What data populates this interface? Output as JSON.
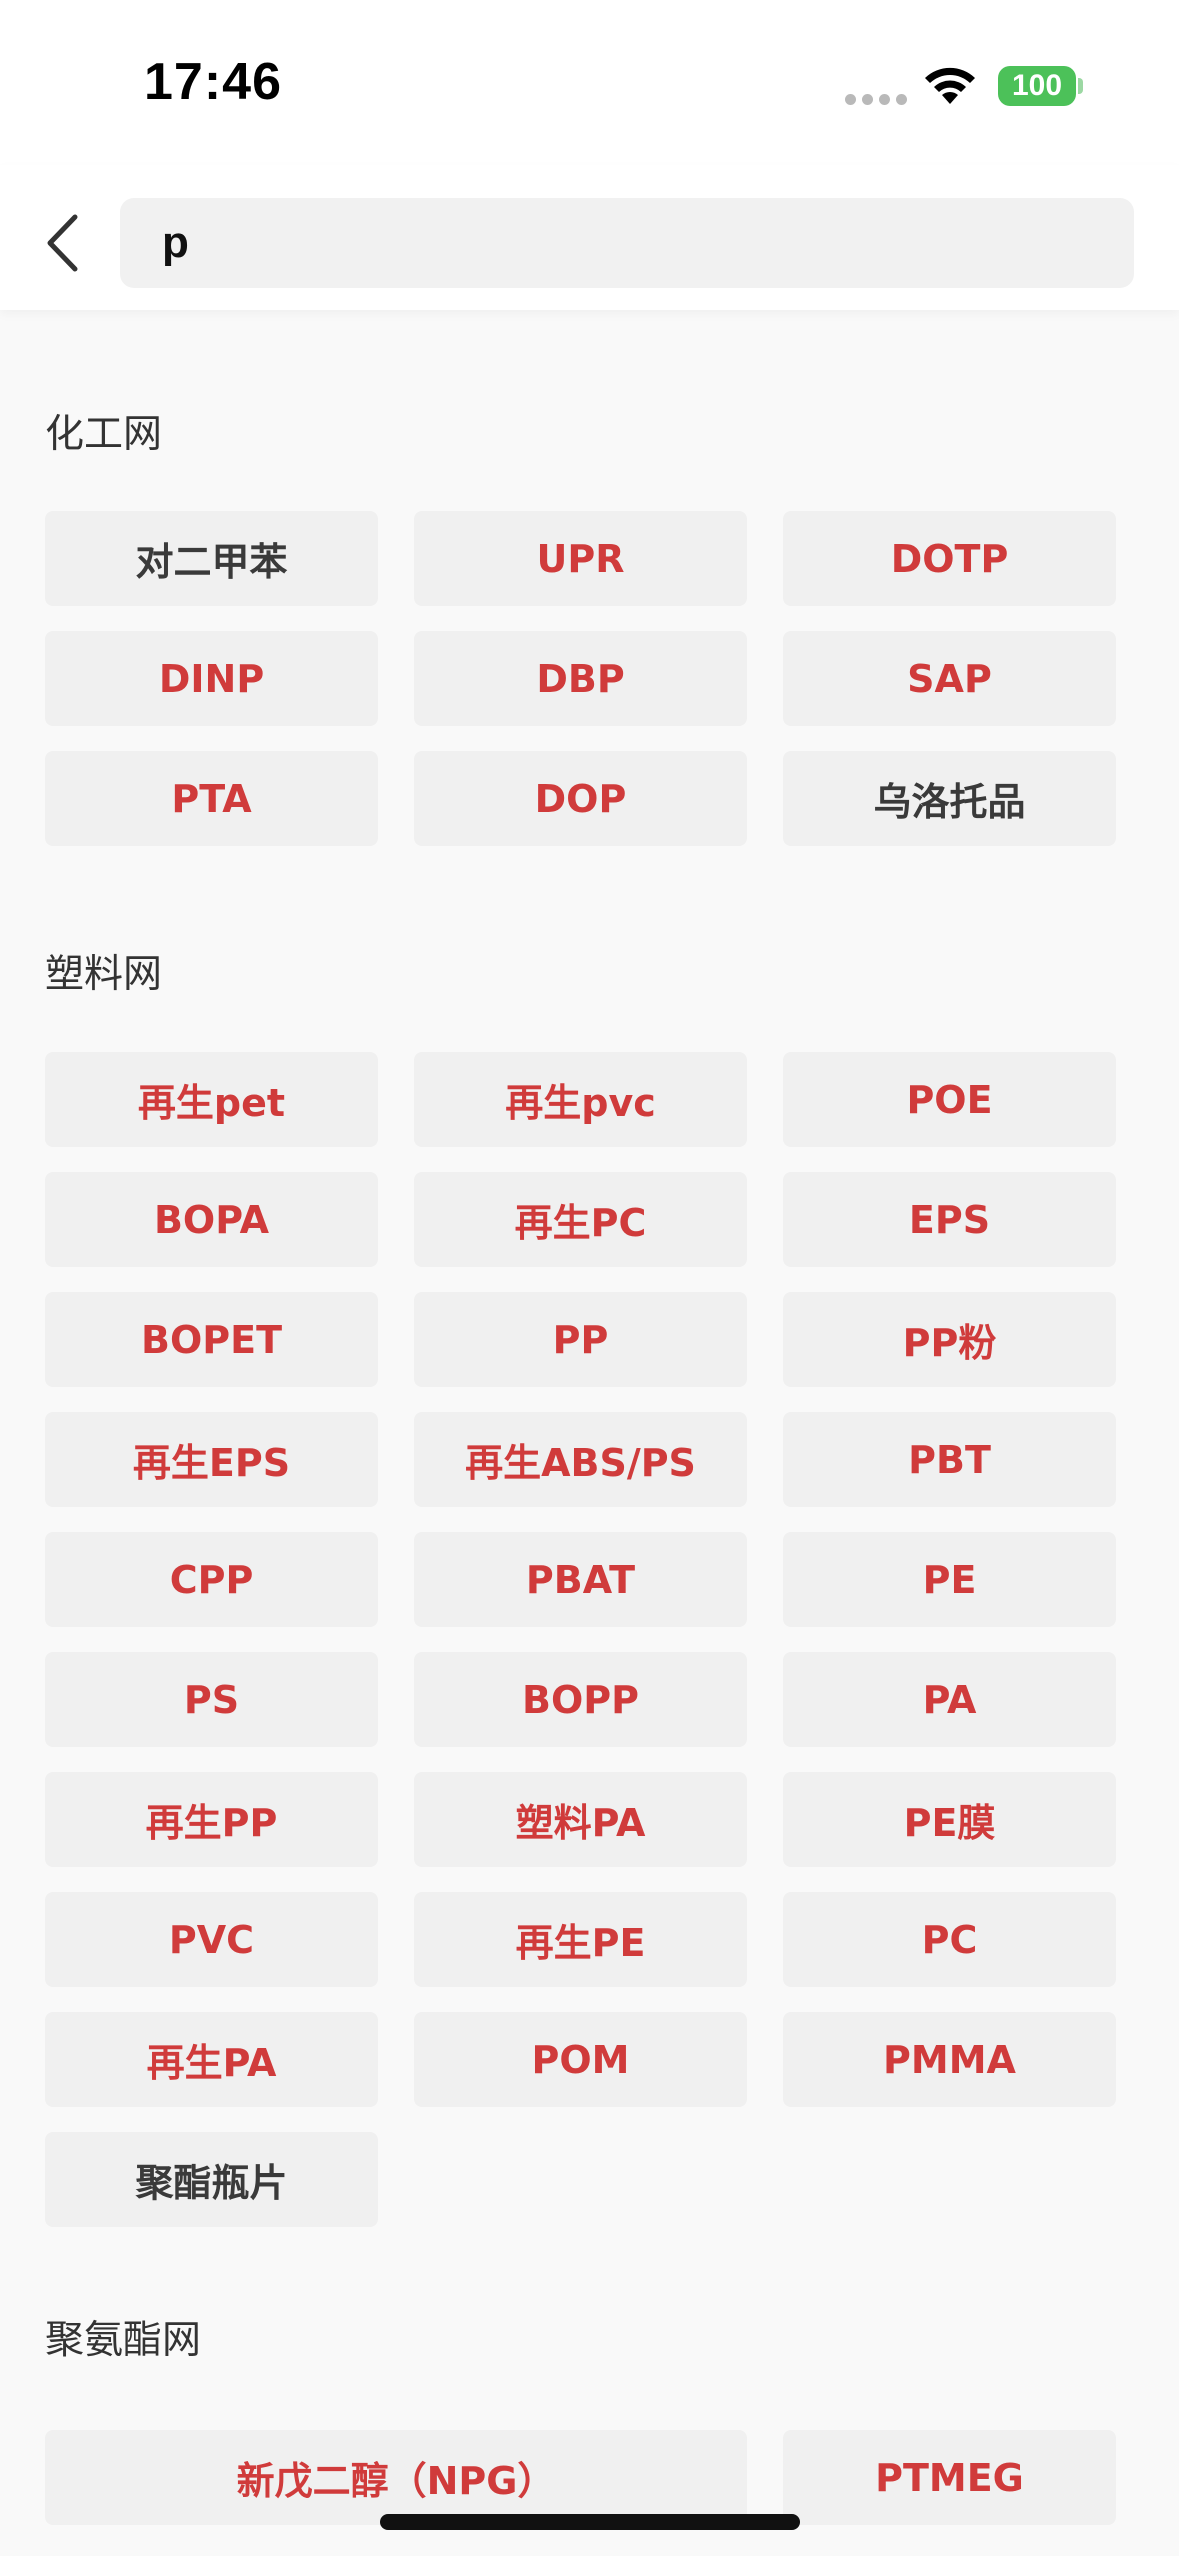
{
  "status_bar": {
    "time": "17:46",
    "battery": "100",
    "icons": [
      "signal-dots-icon",
      "wifi-icon",
      "battery-icon"
    ]
  },
  "nav": {
    "back_icon": "chevron-left-icon",
    "search_value": "p"
  },
  "sections": [
    {
      "title": "化工网",
      "items": [
        {
          "label": "对二甲苯",
          "highlight": false
        },
        {
          "label": "UPR",
          "highlight": true
        },
        {
          "label": "DOTP",
          "highlight": true
        },
        {
          "label": "DINP",
          "highlight": true
        },
        {
          "label": "DBP",
          "highlight": true
        },
        {
          "label": "SAP",
          "highlight": true
        },
        {
          "label": "PTA",
          "highlight": true
        },
        {
          "label": "DOP",
          "highlight": true
        },
        {
          "label": "乌洛托品",
          "highlight": false
        }
      ]
    },
    {
      "title": "塑料网",
      "items": [
        {
          "label": "再生pet",
          "highlight": true
        },
        {
          "label": "再生pvc",
          "highlight": true
        },
        {
          "label": "POE",
          "highlight": true
        },
        {
          "label": "BOPA",
          "highlight": true
        },
        {
          "label": "再生PC",
          "highlight": true
        },
        {
          "label": "EPS",
          "highlight": true
        },
        {
          "label": "BOPET",
          "highlight": true
        },
        {
          "label": "PP",
          "highlight": true
        },
        {
          "label": "PP粉",
          "highlight": true
        },
        {
          "label": "再生EPS",
          "highlight": true
        },
        {
          "label": "再生ABS/PS",
          "highlight": true
        },
        {
          "label": "PBT",
          "highlight": true
        },
        {
          "label": "CPP",
          "highlight": true
        },
        {
          "label": "PBAT",
          "highlight": true
        },
        {
          "label": "PE",
          "highlight": true
        },
        {
          "label": "PS",
          "highlight": true
        },
        {
          "label": "BOPP",
          "highlight": true
        },
        {
          "label": "PA",
          "highlight": true
        },
        {
          "label": "再生PP",
          "highlight": true
        },
        {
          "label": "塑料PA",
          "highlight": true
        },
        {
          "label": "PE膜",
          "highlight": true
        },
        {
          "label": "PVC",
          "highlight": true
        },
        {
          "label": "再生PE",
          "highlight": true
        },
        {
          "label": "PC",
          "highlight": true
        },
        {
          "label": "再生PA",
          "highlight": true
        },
        {
          "label": "POM",
          "highlight": true
        },
        {
          "label": "PMMA",
          "highlight": true
        },
        {
          "label": "聚酯瓶片",
          "highlight": false
        }
      ]
    },
    {
      "title": "聚氨酯网",
      "items": [
        {
          "label": "新戊二醇（NPG）",
          "highlight": true,
          "wide": true
        },
        {
          "label": "PTMEG",
          "highlight": true
        }
      ]
    }
  ],
  "colors": {
    "highlight": "#d03b3b",
    "plain": "#3a3a3a",
    "chip_bg": "#f0f0f0",
    "battery": "#4cc159"
  }
}
